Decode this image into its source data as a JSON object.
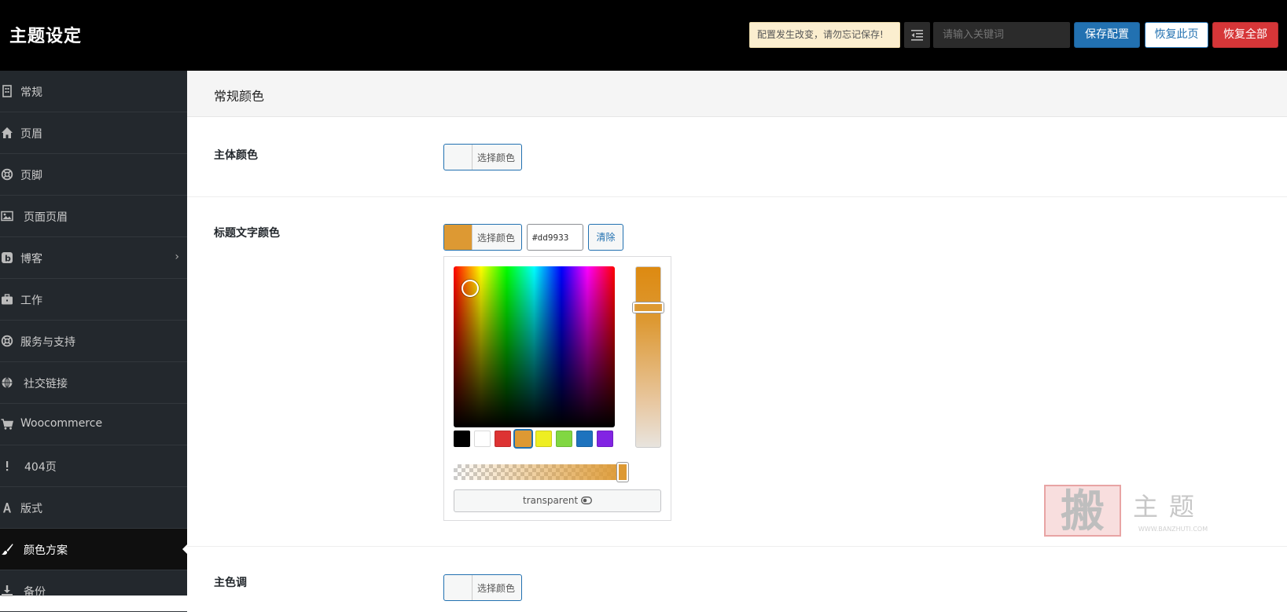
{
  "header": {
    "title": "主题设定",
    "notice": "配置发生改变，请勿忘记保存!",
    "search_placeholder": "请输入关键词",
    "save_label": "保存配置",
    "reset_page_label": "恢复此页",
    "reset_all_label": "恢复全部"
  },
  "sidebar": {
    "items": [
      {
        "label": "常规",
        "icon": "building-icon"
      },
      {
        "label": "页眉",
        "icon": "home-icon"
      },
      {
        "label": "页脚",
        "icon": "lifebuoy-icon"
      },
      {
        "label": "页面页眉",
        "icon": "image-icon"
      },
      {
        "label": "博客",
        "icon": "bold-icon",
        "has_children": true
      },
      {
        "label": "工作",
        "icon": "briefcase-icon"
      },
      {
        "label": "服务与支持",
        "icon": "lifebuoy-icon"
      },
      {
        "label": "社交链接",
        "icon": "globe-icon"
      },
      {
        "label": "Woocommerce",
        "icon": "cart-icon"
      },
      {
        "label": "404页",
        "icon": "exclamation-icon"
      },
      {
        "label": "版式",
        "icon": "font-icon"
      },
      {
        "label": "颜色方案",
        "icon": "paint-brush-icon",
        "active": true
      },
      {
        "label": "备份",
        "icon": "download-icon"
      }
    ]
  },
  "main": {
    "section_title": "常规颜色",
    "fields": [
      {
        "label": "主体颜色",
        "button_label": "选择颜色",
        "color": ""
      },
      {
        "label": "标题文字颜色",
        "button_label": "选择颜色",
        "color": "#dd9933",
        "hex_value": "#dd9933",
        "clear_label": "清除"
      },
      {
        "label": "主色调",
        "button_label": "选择颜色",
        "color": ""
      }
    ],
    "picker": {
      "palette": [
        "#000000",
        "#ffffff",
        "#dd3333",
        "#dd9933",
        "#eeee22",
        "#81d742",
        "#1e73be",
        "#8224e3"
      ],
      "selected": "#dd9933",
      "transparent_label": "transparent"
    }
  },
  "watermark": {
    "text": "搬主题",
    "url": "WWW.BANZHUTI.COM"
  }
}
